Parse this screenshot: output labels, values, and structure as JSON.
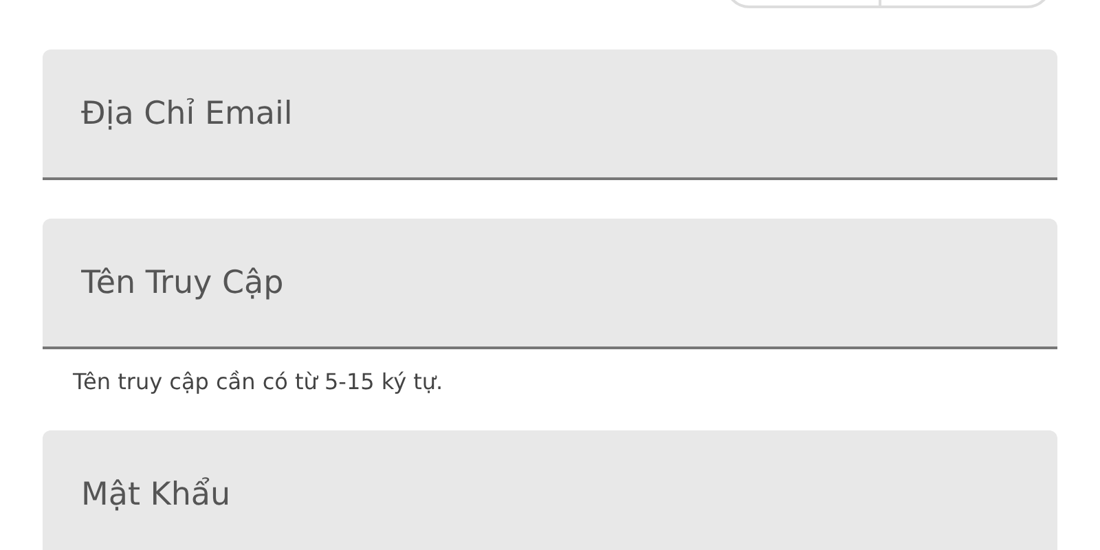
{
  "fields": [
    {
      "placeholder": "Địa Chỉ Email"
    },
    {
      "placeholder": "Tên Truy Cập",
      "hint": "Tên truy cập cần có từ 5-15 ký tự."
    },
    {
      "placeholder": "Mật Khẩu"
    }
  ]
}
